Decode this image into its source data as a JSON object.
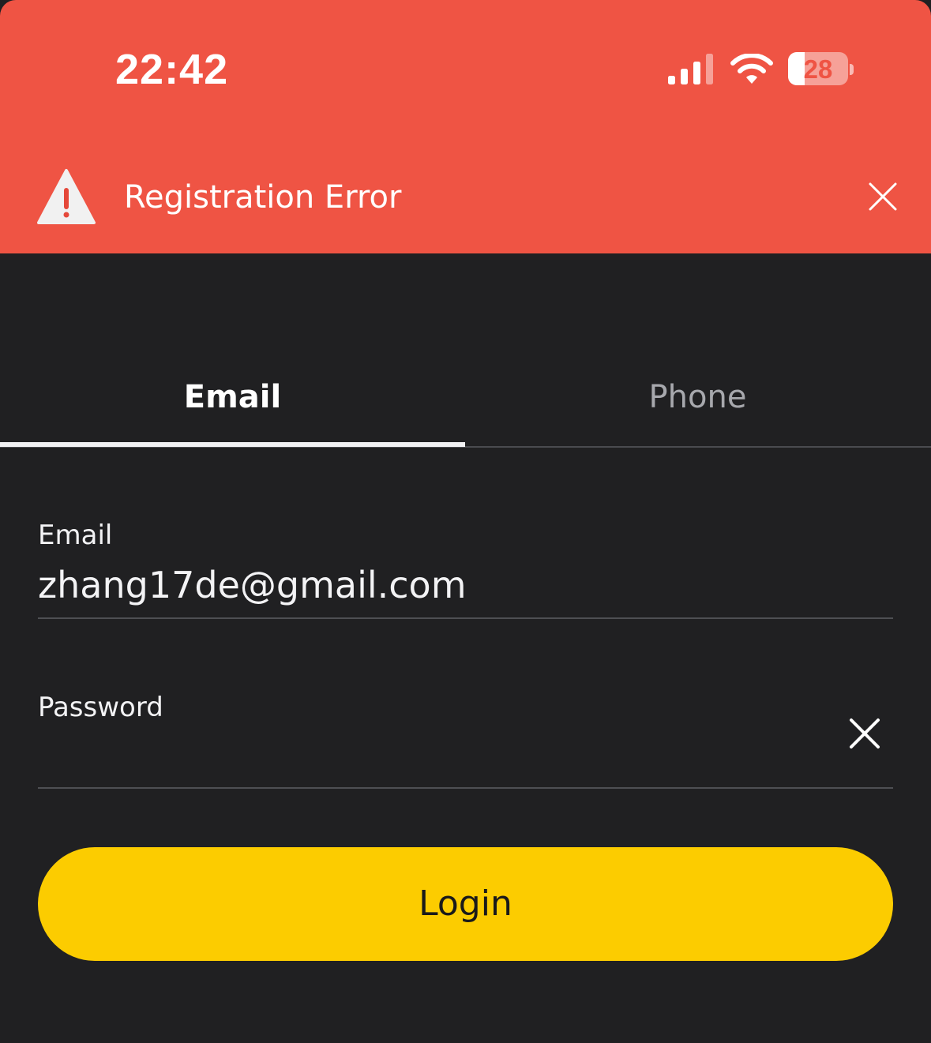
{
  "status_bar": {
    "time": "22:42",
    "battery_level": "28",
    "battery_fraction": 0.28,
    "signal_bars_active": 3,
    "signal_bars_total": 4
  },
  "error_banner": {
    "title": "Registration Error",
    "icon": "warning-icon",
    "close_icon": "close-icon",
    "background_color": "#EF5444"
  },
  "tabs": [
    {
      "label": "Email",
      "selected": true
    },
    {
      "label": "Phone",
      "selected": false
    }
  ],
  "form": {
    "email": {
      "label": "Email",
      "value": "zhang17de@gmail.com"
    },
    "password": {
      "label": "Password",
      "value": "",
      "clear_icon": "clear-icon"
    }
  },
  "login_button": {
    "label": "Login",
    "color": "#FCCC00"
  },
  "theme": {
    "background": "#202022",
    "accent": "#FCCC00",
    "error": "#EF5444"
  }
}
